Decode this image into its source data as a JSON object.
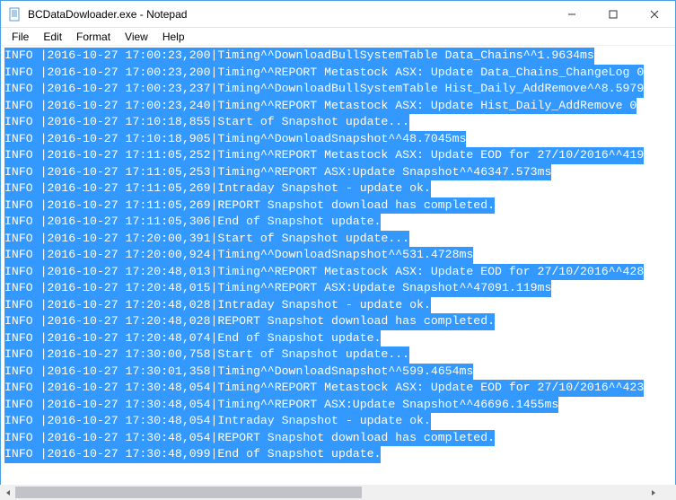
{
  "window": {
    "title": "BCDataDowloader.exe - Notepad"
  },
  "menu": {
    "file": "File",
    "edit": "Edit",
    "format": "Format",
    "view": "View",
    "help": "Help"
  },
  "log": {
    "lines": [
      "INFO |2016-10-27 17:00:23,200|Timing^^DownloadBullSystemTable Data_Chains^^1.9634ms",
      "INFO |2016-10-27 17:00:23,200|Timing^^REPORT Metastock ASX: Update Data_Chains_ChangeLog 0",
      "INFO |2016-10-27 17:00:23,237|Timing^^DownloadBullSystemTable Hist_Daily_AddRemove^^8.5979",
      "INFO |2016-10-27 17:00:23,240|Timing^^REPORT Metastock ASX: Update Hist_Daily_AddRemove 0",
      "INFO |2016-10-27 17:10:18,855|Start of Snapshot update...",
      "INFO |2016-10-27 17:10:18,905|Timing^^DownloadSnapshot^^48.7045ms",
      "INFO |2016-10-27 17:11:05,252|Timing^^REPORT Metastock ASX: Update EOD for 27/10/2016^^419",
      "INFO |2016-10-27 17:11:05,253|Timing^^REPORT ASX:Update Snapshot^^46347.573ms",
      "INFO |2016-10-27 17:11:05,269|Intraday Snapshot - update ok.",
      "INFO |2016-10-27 17:11:05,269|REPORT Snapshot download has completed.",
      "INFO |2016-10-27 17:11:05,306|End of Snapshot update.",
      "INFO |2016-10-27 17:20:00,391|Start of Snapshot update...",
      "INFO |2016-10-27 17:20:00,924|Timing^^DownloadSnapshot^^531.4728ms",
      "INFO |2016-10-27 17:20:48,013|Timing^^REPORT Metastock ASX: Update EOD for 27/10/2016^^428",
      "INFO |2016-10-27 17:20:48,015|Timing^^REPORT ASX:Update Snapshot^^47091.119ms",
      "INFO |2016-10-27 17:20:48,028|Intraday Snapshot - update ok.",
      "INFO |2016-10-27 17:20:48,028|REPORT Snapshot download has completed.",
      "INFO |2016-10-27 17:20:48,074|End of Snapshot update.",
      "INFO |2016-10-27 17:30:00,758|Start of Snapshot update...",
      "INFO |2016-10-27 17:30:01,358|Timing^^DownloadSnapshot^^599.4654ms",
      "INFO |2016-10-27 17:30:48,054|Timing^^REPORT Metastock ASX: Update EOD for 27/10/2016^^423",
      "INFO |2016-10-27 17:30:48,054|Timing^^REPORT ASX:Update Snapshot^^46696.1455ms",
      "INFO |2016-10-27 17:30:48,054|Intraday Snapshot - update ok.",
      "INFO |2016-10-27 17:30:48,054|REPORT Snapshot download has completed.",
      "INFO |2016-10-27 17:30:48,099|End of Snapshot update."
    ]
  }
}
